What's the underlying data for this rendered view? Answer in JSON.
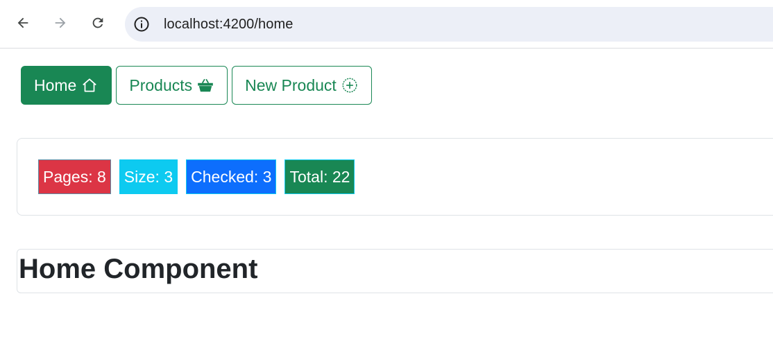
{
  "browser": {
    "url": "localhost:4200/home",
    "icons": {
      "back": "arrow-left-icon",
      "forward": "arrow-right-icon",
      "reload": "reload-icon",
      "site_info": "info-icon"
    }
  },
  "nav": {
    "items": [
      {
        "label": "Home",
        "icon": "house-icon",
        "active": true
      },
      {
        "label": "Products",
        "icon": "basket-icon",
        "active": false
      },
      {
        "label": "New Product",
        "icon": "plus-circle-icon",
        "active": false
      }
    ]
  },
  "stats": {
    "pages": "Pages: 8",
    "size": "Size: 3",
    "checked": "Checked: 3",
    "total": "Total: 22"
  },
  "home": {
    "title": "Home Component"
  },
  "colors": {
    "success": "#198754",
    "danger": "#dc3545",
    "info": "#0dcaf0",
    "primary": "#0d6efd"
  }
}
